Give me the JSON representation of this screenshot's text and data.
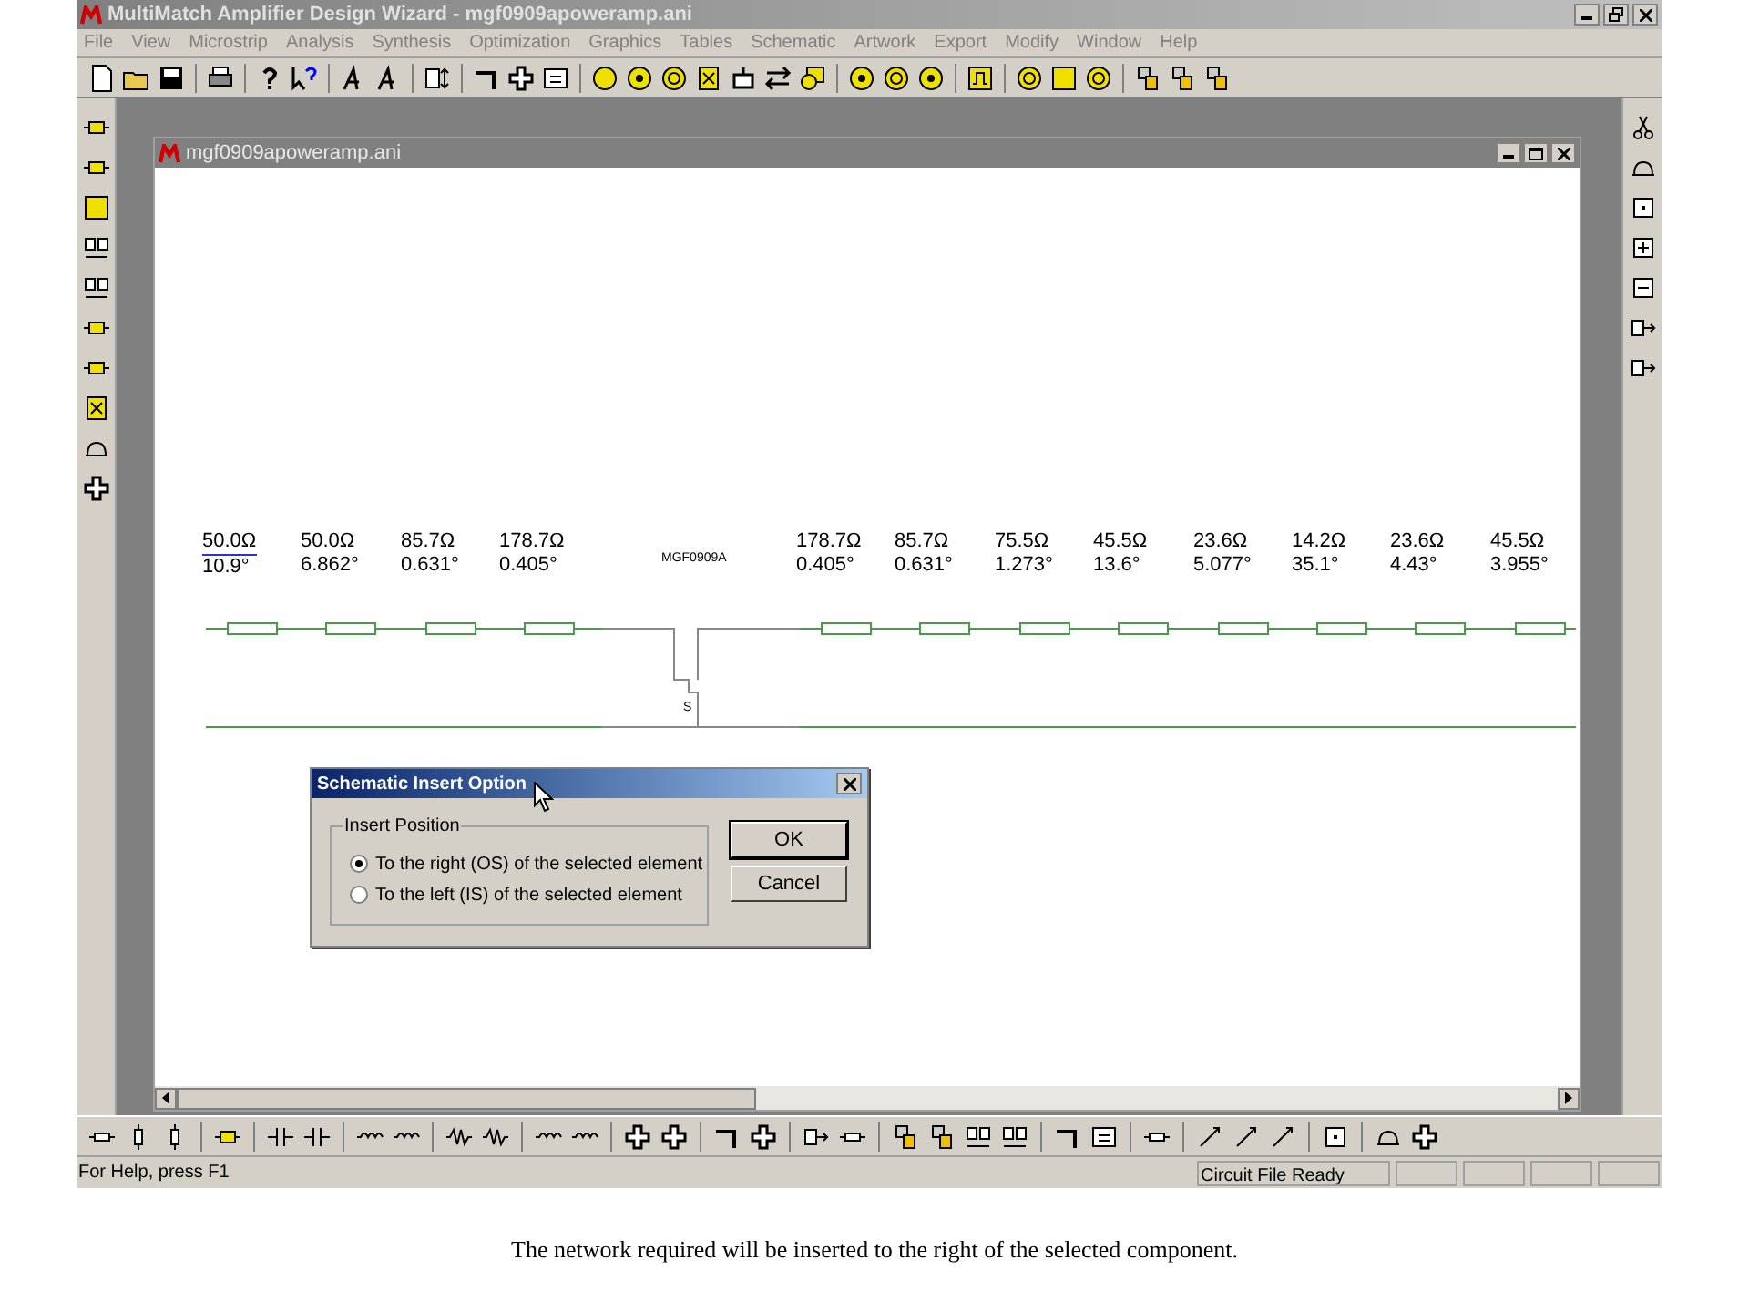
{
  "window": {
    "title": "MultiMatch Amplifier Design Wizard - mgf0909apoweramp.ani"
  },
  "menu": [
    "File",
    "View",
    "Microstrip",
    "Analysis",
    "Synthesis",
    "Optimization",
    "Graphics",
    "Tables",
    "Schematic",
    "Artwork",
    "Export",
    "Modify",
    "Window",
    "Help"
  ],
  "document": {
    "title": "mgf0909apoweramp.ani",
    "input_elements": [
      {
        "impedance": "50.0Ω",
        "angle": "10.9°",
        "selected": true
      },
      {
        "impedance": "50.0Ω",
        "angle": "6.862°",
        "selected": false
      },
      {
        "impedance": "85.7Ω",
        "angle": "0.631°",
        "selected": false
      },
      {
        "impedance": "178.7Ω",
        "angle": "0.405°",
        "selected": false
      }
    ],
    "device": {
      "label": "MGF0909A",
      "terminal": "S"
    },
    "output_elements": [
      {
        "impedance": "178.7Ω",
        "angle": "0.405°",
        "selected": false
      },
      {
        "impedance": "85.7Ω",
        "angle": "0.631°",
        "selected": false
      },
      {
        "impedance": "75.5Ω",
        "angle": "1.273°",
        "selected": false
      },
      {
        "impedance": "45.5Ω",
        "angle": "13.6°",
        "selected": false
      },
      {
        "impedance": "23.6Ω",
        "angle": "5.077°",
        "selected": false
      },
      {
        "impedance": "14.2Ω",
        "angle": "35.1°",
        "selected": false
      },
      {
        "impedance": "23.6Ω",
        "angle": "4.43°",
        "selected": false
      },
      {
        "impedance": "45.5Ω",
        "angle": "3.955°",
        "selected": false
      }
    ]
  },
  "dialog": {
    "title": "Schematic Insert Option",
    "group": "Insert Position",
    "options": [
      {
        "label": "To the right (OS) of the selected element",
        "selected": true
      },
      {
        "label": "To the left (IS) of the selected element",
        "selected": false
      }
    ],
    "buttons": [
      "OK",
      "Cancel"
    ]
  },
  "status_bar": {
    "help": "For Help, press F1",
    "state": "Circuit File Ready"
  },
  "caption": "The network required will be inserted to the right of the selected component."
}
